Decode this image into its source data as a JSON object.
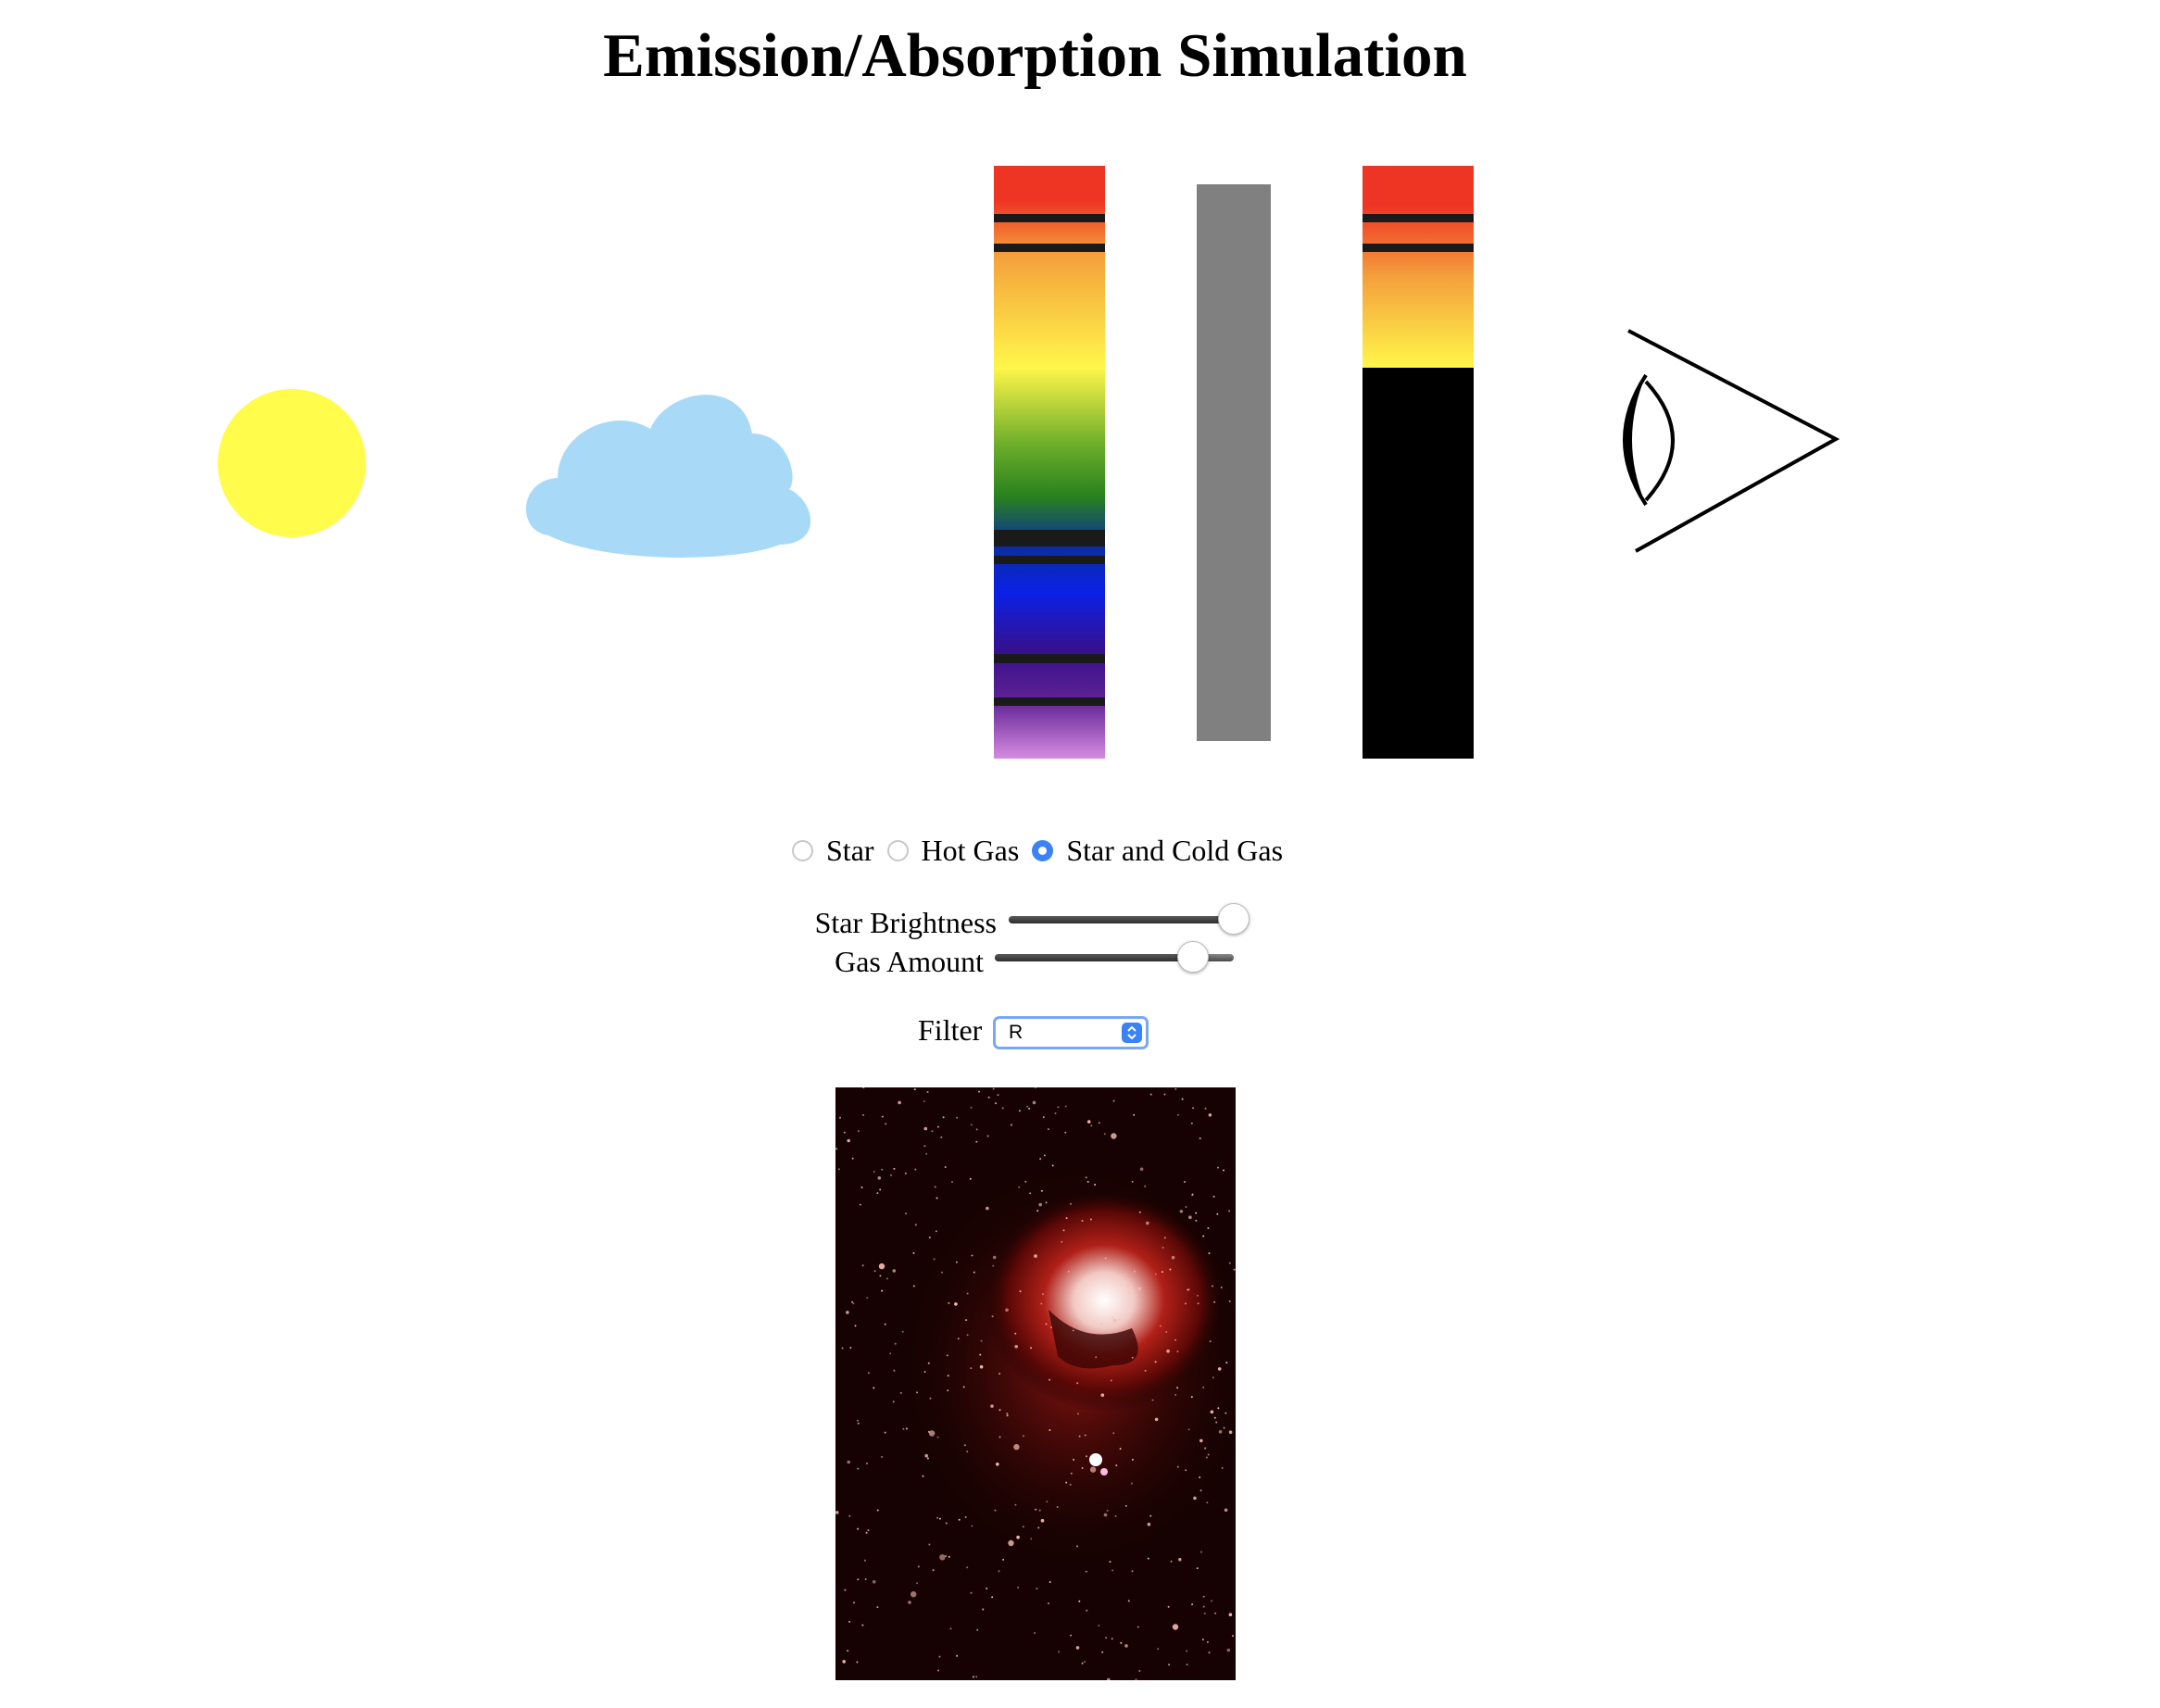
{
  "page": {
    "title": "Emission/Absorption Simulation"
  },
  "scene": {
    "star_color": "#FFFC4C",
    "cloud_color": "#A8DAF8",
    "prism_color": "#808080",
    "icons": [
      "star-icon",
      "cloud-icon",
      "eye-icon"
    ]
  },
  "mode": {
    "options": [
      "Star",
      "Hot Gas",
      "Star and Cold Gas"
    ],
    "selected": "Star and Cold Gas"
  },
  "controls": {
    "star_brightness_label": "Star Brightness",
    "star_brightness_value": 1.0,
    "gas_amount_label": "Gas Amount",
    "gas_amount_value": 0.83,
    "filter_label": "Filter",
    "filter_value": "R"
  },
  "colors": {
    "accent": "#3B82F6",
    "select_border": "#7AA7F2"
  }
}
